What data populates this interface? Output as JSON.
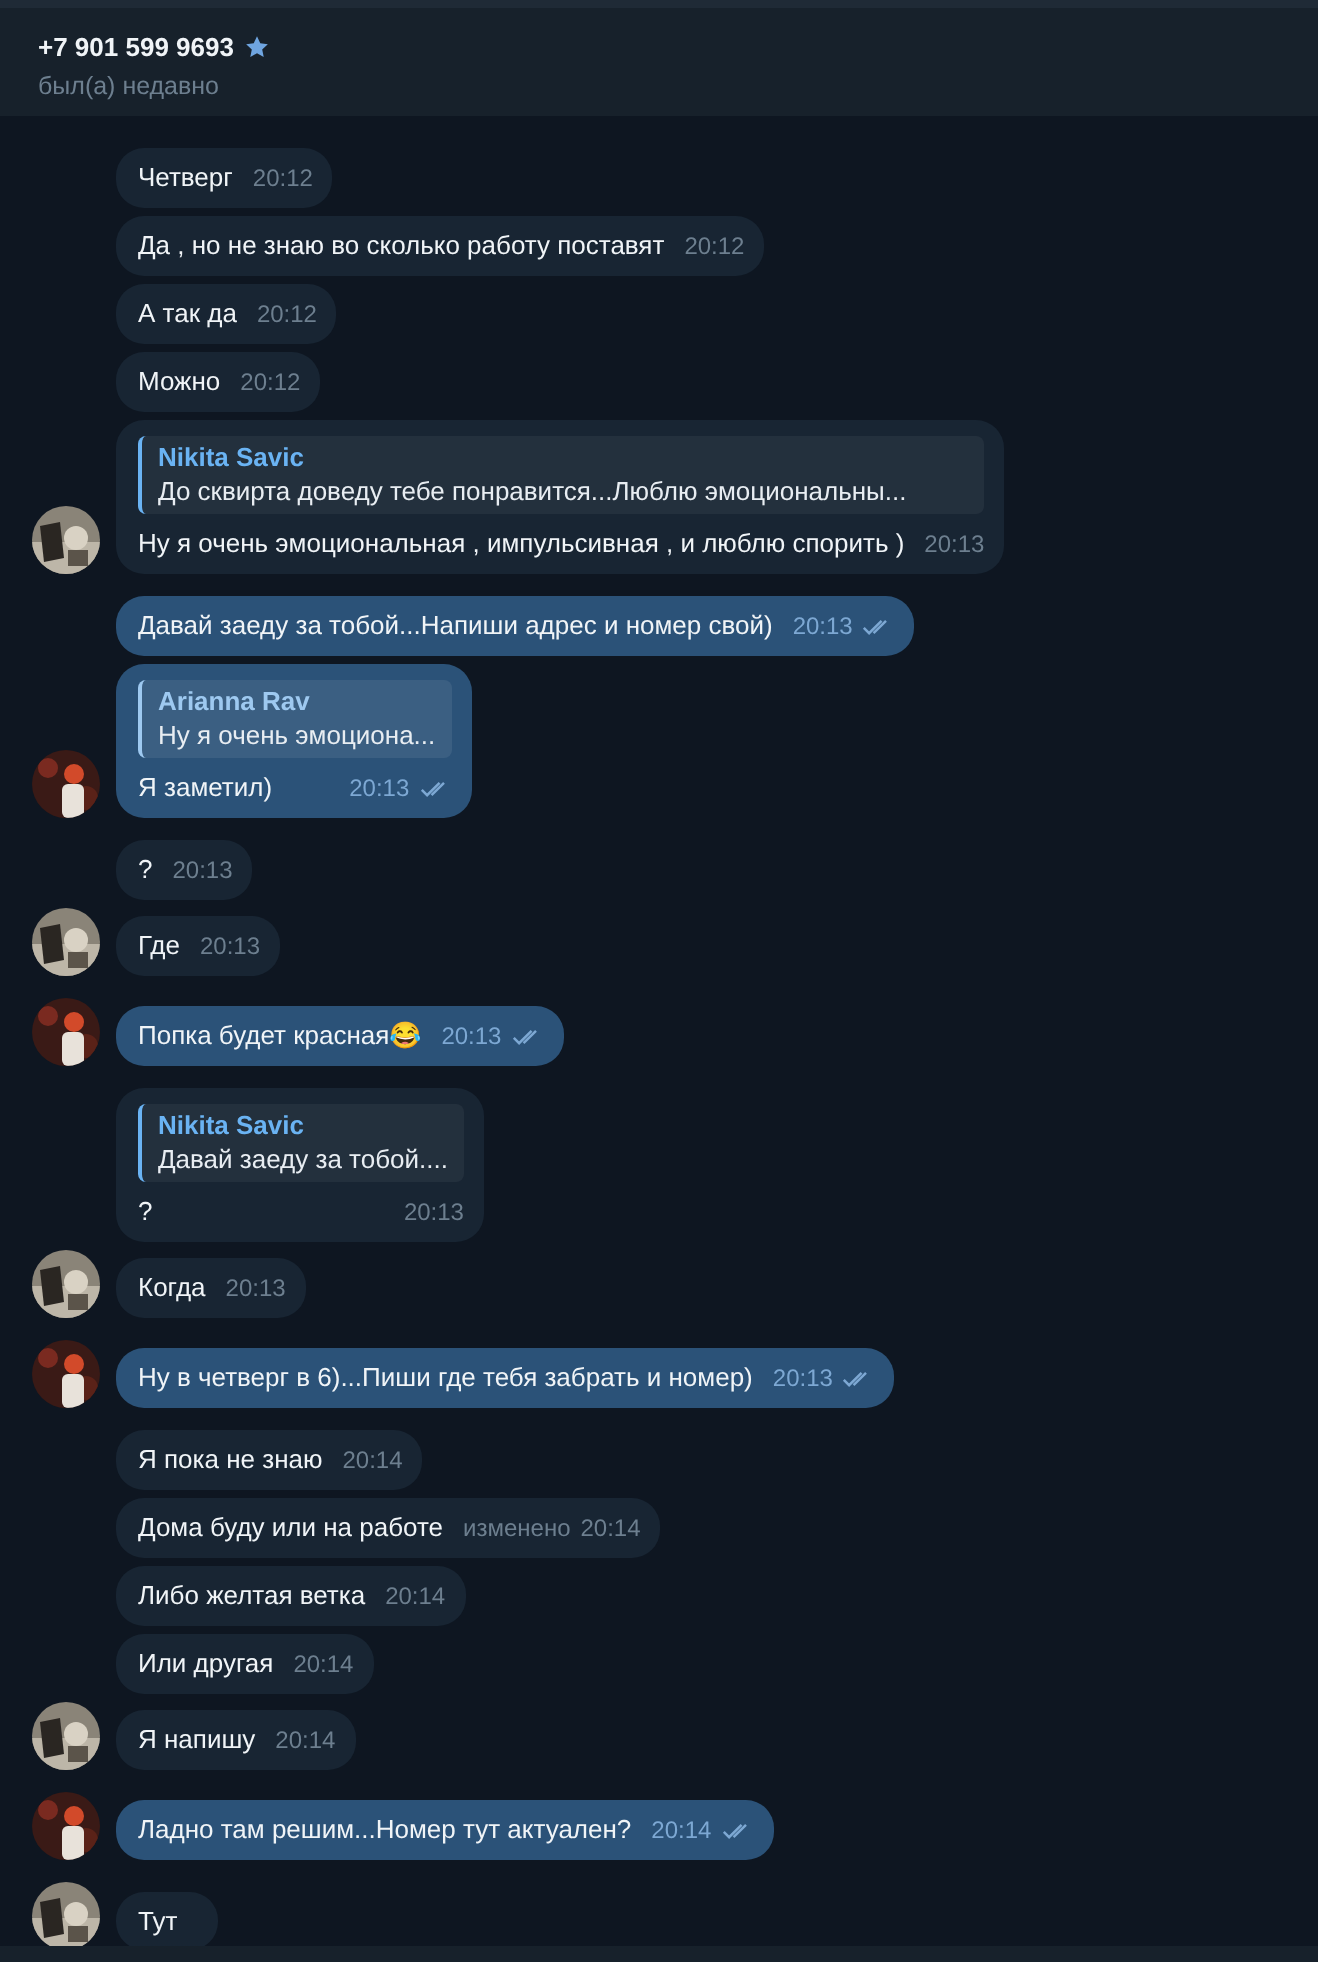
{
  "header": {
    "title": "+7 901 599 9693",
    "status": "был(а) недавно"
  },
  "messages": [
    {
      "kind": "in",
      "text": "Четверг",
      "time": "20:12",
      "avatar": false
    },
    {
      "kind": "in",
      "text": "Да , но не знаю во сколько работу поставят",
      "time": "20:12",
      "avatar": false
    },
    {
      "kind": "in",
      "text": "А так да",
      "time": "20:12",
      "avatar": false
    },
    {
      "kind": "in",
      "text": "Можно",
      "time": "20:12",
      "avatar": false
    },
    {
      "kind": "in",
      "reply": {
        "name": "Nikita Savic",
        "text": "До сквирта доведу тебе понравится...Люблю эмоциональны..."
      },
      "text": "Ну я очень эмоциональная , импульсивная , и люблю спорить )",
      "time": "20:13",
      "avatar": true
    },
    {
      "kind": "out",
      "text": "Давай заеду за тобой...Напиши адрес и номер свой)",
      "time": "20:13",
      "read": true,
      "avatar": false
    },
    {
      "kind": "out",
      "reply": {
        "name": "Arianna Rav",
        "text": "Ну я очень эмоциона..."
      },
      "text": "Я заметил)",
      "time": "20:13",
      "read": true,
      "avatar": true
    },
    {
      "kind": "in",
      "text": "?",
      "time": "20:13",
      "avatar": false
    },
    {
      "kind": "in",
      "text": "Где",
      "time": "20:13",
      "avatar": true
    },
    {
      "kind": "out",
      "text": "Попка будет красная😂",
      "time": "20:13",
      "read": true,
      "avatar": true
    },
    {
      "kind": "in",
      "reply": {
        "name": "Nikita Savic",
        "text": "Давай заеду за тобой...."
      },
      "text": "?",
      "time": "20:13",
      "avatar": false
    },
    {
      "kind": "in",
      "text": "Когда",
      "time": "20:13",
      "avatar": true
    },
    {
      "kind": "out",
      "text": "Ну в четверг в 6)...Пиши где тебя забрать и номер)",
      "time": "20:13",
      "read": true,
      "avatar": true
    },
    {
      "kind": "in",
      "text": "Я пока не знаю",
      "time": "20:14",
      "avatar": false
    },
    {
      "kind": "in",
      "text": "Дома буду или на работе",
      "edited": "изменено",
      "time": "20:14",
      "avatar": false
    },
    {
      "kind": "in",
      "text": "Либо желтая ветка",
      "time": "20:14",
      "avatar": false
    },
    {
      "kind": "in",
      "text": "Или другая",
      "time": "20:14",
      "avatar": false
    },
    {
      "kind": "in",
      "text": "Я напишу",
      "time": "20:14",
      "avatar": true
    },
    {
      "kind": "out",
      "text": "Ладно там решим...Номер тут актуален?",
      "time": "20:14",
      "read": true,
      "avatar": true
    },
    {
      "kind": "in",
      "text": "Тут",
      "avatar": true
    }
  ]
}
